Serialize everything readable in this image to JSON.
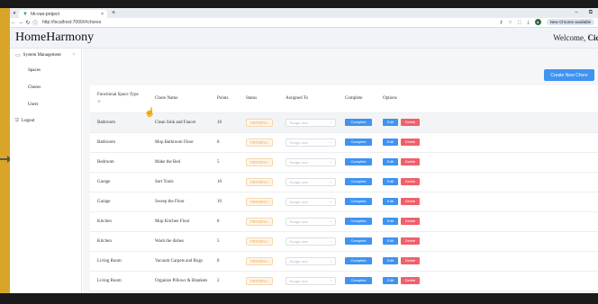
{
  "browser": {
    "tab_title": "hh-vue-project",
    "new_tab": "+",
    "url": "http://localhost:7000/#/chores",
    "chrome_pill": "New Chrome available",
    "minimize": "–",
    "restore": "⧉"
  },
  "app": {
    "brand": "HomeHarmony",
    "welcome_prefix": "Welcome, ",
    "welcome_name": "Cicl"
  },
  "sidebar": {
    "system_management": "System Management",
    "items": [
      {
        "label": "Spaces"
      },
      {
        "label": "Chores"
      },
      {
        "label": "Users"
      }
    ],
    "logout": "Logout"
  },
  "main": {
    "create_button": "Create New Chore",
    "columns": [
      "Functional Space Type",
      "Chore Name",
      "Points",
      "Status",
      "Assigned To",
      "Complete",
      "Options"
    ],
    "assign_placeholder": "Assign user",
    "complete_label": "Complete",
    "edit_label": "Edit",
    "delete_label": "Delete",
    "rows": [
      {
        "space": "Bathroom",
        "name": "Clean Sink and Faucet",
        "points": "10",
        "status": "PENDING"
      },
      {
        "space": "Bathroom",
        "name": "Mop Bathroom Floor",
        "points": "8",
        "status": "PENDING"
      },
      {
        "space": "Bedroom",
        "name": "Make the Bed",
        "points": "5",
        "status": "PENDING"
      },
      {
        "space": "Garage",
        "name": "Sort Tools",
        "points": "10",
        "status": "PENDING"
      },
      {
        "space": "Garage",
        "name": "Sweep the Floor",
        "points": "10",
        "status": "PENDING"
      },
      {
        "space": "Kitchen",
        "name": "Mop Kitchen Floor",
        "points": "8",
        "status": "PENDING"
      },
      {
        "space": "Kitchen",
        "name": "Wash the dishes",
        "points": "5",
        "status": "PENDING"
      },
      {
        "space": "Living Room",
        "name": "Vacuum Carpets and Rugs",
        "points": "8",
        "status": "PENDING"
      },
      {
        "space": "Living Room",
        "name": "Organize Pillows & Blankets",
        "points": "2",
        "status": "PENDING"
      }
    ]
  },
  "colors": {
    "primary": "#3f93f1",
    "danger": "#f0606b",
    "pending": "#f0a44a",
    "add": "#2ea86b"
  }
}
